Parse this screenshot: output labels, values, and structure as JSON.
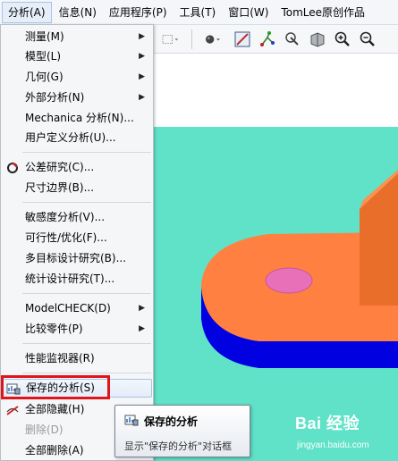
{
  "menubar": {
    "items": [
      {
        "label": "分析(A)"
      },
      {
        "label": "信息(N)"
      },
      {
        "label": "应用程序(P)"
      },
      {
        "label": "工具(T)"
      },
      {
        "label": "窗口(W)"
      },
      {
        "label": "TomLee原创作品"
      }
    ]
  },
  "menu": {
    "items": [
      {
        "label": "测量(M)",
        "submenu": true
      },
      {
        "label": "模型(L)",
        "submenu": true
      },
      {
        "label": "几何(G)",
        "submenu": true
      },
      {
        "label": "外部分析(N)",
        "submenu": true
      },
      {
        "label": "Mechanica 分析(N)..."
      },
      {
        "label": "用户定义分析(U)..."
      },
      {
        "label": "公差研究(C)...",
        "icon": "tolerance-icon"
      },
      {
        "label": "尺寸边界(B)..."
      },
      {
        "label": "敏感度分析(V)..."
      },
      {
        "label": "可行性/优化(F)..."
      },
      {
        "label": "多目标设计研究(B)..."
      },
      {
        "label": "统计设计研究(T)..."
      },
      {
        "label": "ModelCHECK(D)",
        "submenu": true
      },
      {
        "label": "比较零件(P)",
        "submenu": true
      },
      {
        "label": "性能监视器(R)"
      },
      {
        "label": "保存的分析(S)",
        "icon": "saved-analysis-icon",
        "highlighted": true
      },
      {
        "label": "全部隐藏(H)",
        "icon": "hide-all-icon"
      },
      {
        "label": "删除(D)",
        "disabled": true
      },
      {
        "label": "全部删除(A)"
      }
    ]
  },
  "tooltip": {
    "title": "保存的分析",
    "description": "显示\"保存的分析\"对话框"
  },
  "watermark": {
    "brand": "Bai 经验",
    "url": "jingyan.baidu.com"
  },
  "colors": {
    "viewport_bg": "#5fe2c7",
    "part_top": "#ff8040",
    "part_side": "#0000e0",
    "hole": "#e870b8",
    "highlight_box": "#e0141a"
  }
}
